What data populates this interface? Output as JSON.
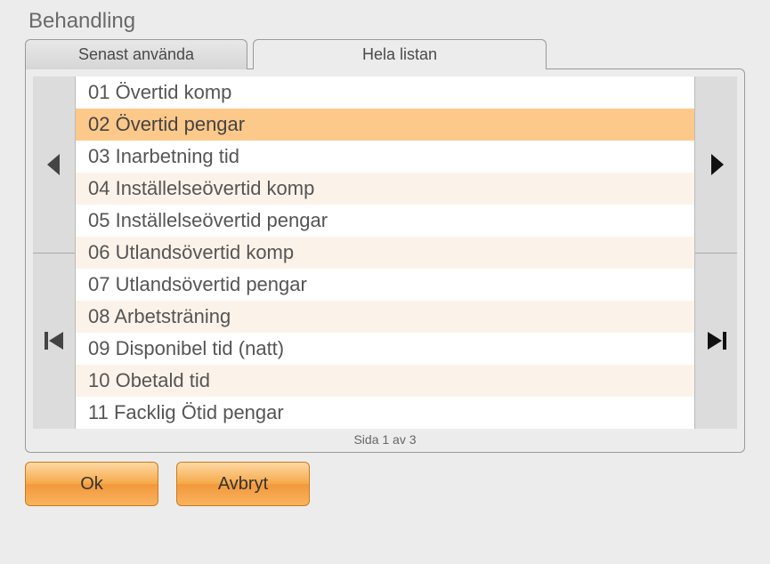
{
  "title": "Behandling",
  "tabs": {
    "recent": "Senast använda",
    "all": "Hela listan"
  },
  "items": [
    {
      "label": "01 Övertid komp",
      "selected": false
    },
    {
      "label": "02 Övertid pengar",
      "selected": true
    },
    {
      "label": "03 Inarbetning tid",
      "selected": false
    },
    {
      "label": "04 Inställelseövertid komp",
      "selected": false
    },
    {
      "label": "05 Inställelseövertid pengar",
      "selected": false
    },
    {
      "label": "06 Utlandsövertid komp",
      "selected": false
    },
    {
      "label": "07 Utlandsövertid pengar",
      "selected": false
    },
    {
      "label": "08 Arbetsträning",
      "selected": false
    },
    {
      "label": "09 Disponibel tid (natt)",
      "selected": false
    },
    {
      "label": "10 Obetald tid",
      "selected": false
    },
    {
      "label": "11 Facklig Ötid pengar",
      "selected": false
    }
  ],
  "pager": "Sida 1 av 3",
  "buttons": {
    "ok": "Ok",
    "cancel": "Avbryt"
  },
  "colors": {
    "accent": "#f6a948",
    "selected": "#fcc98b"
  }
}
